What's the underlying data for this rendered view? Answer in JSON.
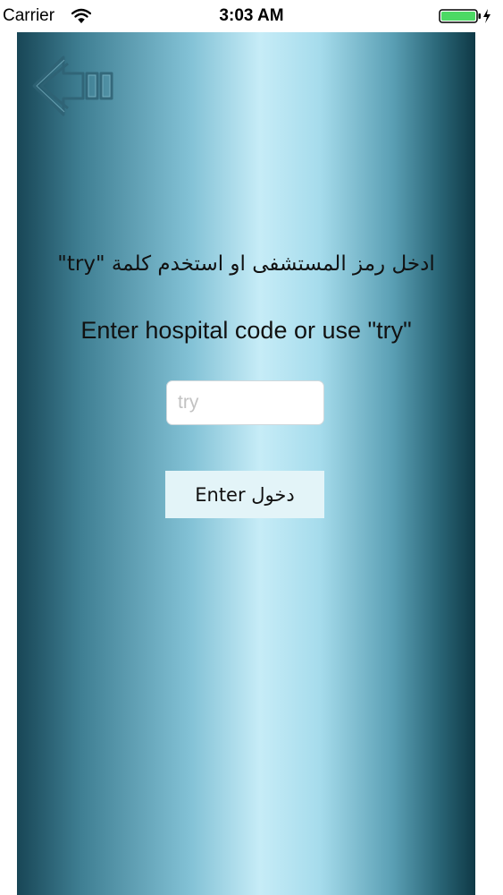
{
  "status_bar": {
    "carrier": "Carrier",
    "time": "3:03 AM",
    "icons": [
      "wifi-icon",
      "battery-charging-icon"
    ]
  },
  "navigation": {
    "back_icon": "back-arrow-icon"
  },
  "prompt": {
    "arabic": "ادخل رمز المستشفى او استخدم كلمة \"try\"",
    "english": "Enter hospital code or use \"try\""
  },
  "code_input": {
    "value": "",
    "placeholder": "try"
  },
  "enter_button": {
    "label": "Enter دخول"
  },
  "colors": {
    "gradient_dark": "#184656",
    "gradient_light": "#c6ecf7",
    "button_bg": "#e3f4f8",
    "battery_green": "#4cd964"
  }
}
